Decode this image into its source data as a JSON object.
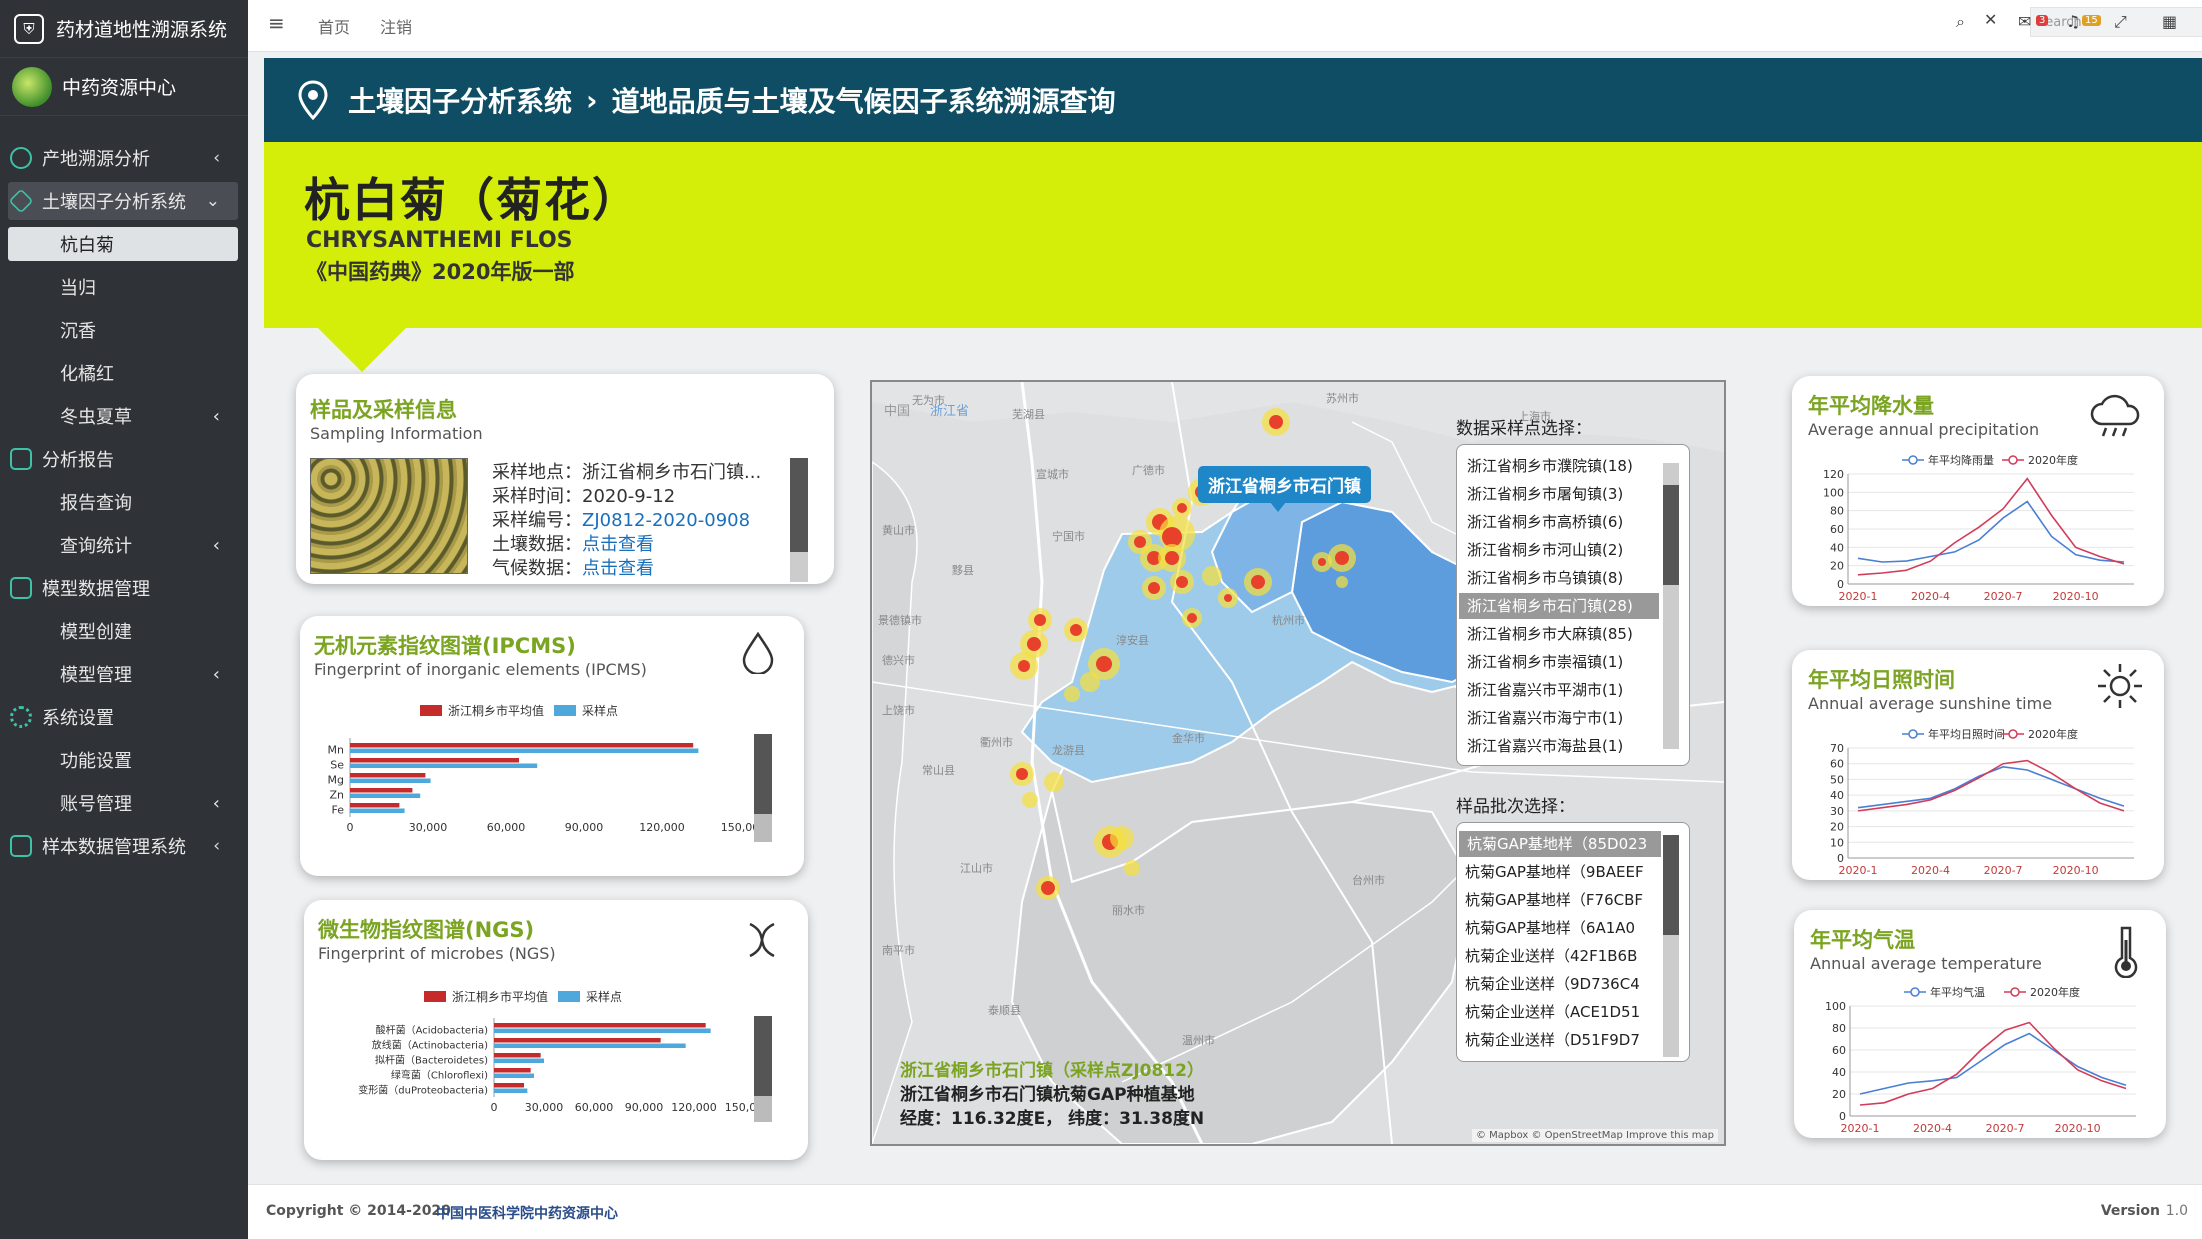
{
  "app": {
    "title": "药材道地性溯源系统",
    "center": "中药资源中心"
  },
  "sidebar": {
    "items": [
      {
        "label": "产地溯源分析"
      },
      {
        "label": "土壤因子分析系统"
      },
      {
        "label": "杭白菊"
      },
      {
        "label": "当归"
      },
      {
        "label": "沉香"
      },
      {
        "label": "化橘红"
      },
      {
        "label": "冬虫夏草"
      },
      {
        "label": "分析报告"
      },
      {
        "label": "报告查询"
      },
      {
        "label": "查询统计"
      },
      {
        "label": "模型数据管理"
      },
      {
        "label": "模型创建"
      },
      {
        "label": "模型管理"
      },
      {
        "label": "系统设置"
      },
      {
        "label": "功能设置"
      },
      {
        "label": "账号管理"
      },
      {
        "label": "样本数据管理系统"
      }
    ]
  },
  "topbar": {
    "home": "首页",
    "logout": "注销",
    "search_placeholder": "Search",
    "msg_count": "3",
    "notif_count": "15"
  },
  "breadcrumb": {
    "part1": "土壤因子分析系统",
    "part2": "道地品质与土壤及气候因子系统溯源查询"
  },
  "herb": {
    "name_cn": "杭白菊（菊花）",
    "name_latin": "CHRYSANTHEMI FLOS",
    "pharmacopoeia": "《中国药典》2020年版一部"
  },
  "sampling": {
    "title": "样品及采样信息",
    "subtitle": "Sampling Information",
    "location_label": "采样地点：",
    "location_value": "浙江省桐乡市石门镇...",
    "time_label": "采样时间：",
    "time_value": "2020-9-12",
    "code_label": "采样编号：",
    "code_value": "ZJ0812-2020-0908",
    "soil_label": "土壤数据：",
    "soil_link": "点击查看",
    "climate_label": "气候数据：",
    "climate_link": "点击查看"
  },
  "ipcms": {
    "title": "无机元素指纹图谱(IPCMS)",
    "subtitle": "Fingerprint of inorganic elements (IPCMS)",
    "legend": [
      "浙江桐乡市平均值",
      "采样点"
    ],
    "chart_data": {
      "type": "bar",
      "categories": [
        "Mn",
        "Se",
        "Mg",
        "Zn",
        "Fe"
      ],
      "series": [
        {
          "name": "浙江桐乡市平均值",
          "values": [
            132000,
            65000,
            29000,
            24000,
            19000
          ],
          "color": "#c62b2b"
        },
        {
          "name": "采样点",
          "values": [
            134000,
            72000,
            31000,
            27000,
            21000
          ],
          "color": "#4fa8dc"
        }
      ],
      "xticks": [
        "0",
        "30,000",
        "60,000",
        "90,000",
        "120,000",
        "150,00"
      ],
      "xlim": [
        0,
        150000
      ]
    }
  },
  "ngs": {
    "title": "微生物指纹图谱(NGS)",
    "subtitle": "Fingerprint of microbes (NGS)",
    "legend": [
      "浙江桐乡市平均值",
      "采样点"
    ],
    "chart_data": {
      "type": "bar",
      "categories": [
        "酸杆菌（Acidobacteria)",
        "放线菌（Actinobacteria)",
        "拟杆菌（Bacteroidetes)",
        "绿弯菌（Chloroflexi)",
        "变形菌（duProteobacteria)"
      ],
      "series": [
        {
          "name": "浙江桐乡市平均值",
          "values": [
            127000,
            100000,
            28000,
            22000,
            18000
          ],
          "color": "#c62b2b"
        },
        {
          "name": "采样点",
          "values": [
            130000,
            115000,
            30000,
            24000,
            20000
          ],
          "color": "#4fa8dc"
        }
      ],
      "xticks": [
        "0",
        "30,000",
        "60,000",
        "90,000",
        "120,000",
        "150,00"
      ],
      "xlim": [
        0,
        150000
      ]
    }
  },
  "map": {
    "tag_cn": "中国",
    "tag_zj": "浙江省",
    "popup": "浙江省桐乡市石门镇",
    "site_title": "浙江省桐乡市石门镇（采样点ZJ0812）",
    "site_desc": "浙江省桐乡市石门镇杭菊GAP种植基地",
    "site_coords": "经度：116.32度E，  纬度：31.38度N",
    "attribution": "© Mapbox © OpenStreetMap Improve this map",
    "place_labels": [
      "无为市",
      "苏州市",
      "芜湖县",
      "广德市",
      "上海市",
      "宣城市",
      "宁国市",
      "杭州市",
      "淳安县",
      "衢州市",
      "龙游县",
      "金华市",
      "丽水市",
      "温州市",
      "台州市",
      "景德镇市",
      "黟县",
      "常山县",
      "江山市",
      "泰顺县",
      "黄山市",
      "南平市",
      "德兴市",
      "上饶市"
    ],
    "sample_point_title": "数据采样点选择：",
    "sample_points": [
      "浙江省桐乡市濮院镇(18)",
      "浙江省桐乡市屠甸镇(3)",
      "浙江省桐乡市高桥镇(6)",
      "浙江省桐乡市河山镇(2)",
      "浙江省桐乡市乌镇镇(8)",
      "浙江省桐乡市石门镇(28)",
      "浙江省桐乡市大麻镇(85)",
      "浙江省桐乡市崇福镇(1)",
      "浙江省嘉兴市平湖市(1)",
      "浙江省嘉兴市海宁市(1)",
      "浙江省嘉兴市海盐县(1)"
    ],
    "batch_title": "样品批次选择：",
    "batches": [
      "杭菊GAP基地样（85D023",
      "杭菊GAP基地样（9BAEEF",
      "杭菊GAP基地样（F76CBF",
      "杭菊GAP基地样（6A1A0",
      "杭菊企业送样（42F1B6B",
      "杭菊企业送样（9D736C4",
      "杭菊企业送样（ACE1D51",
      "杭菊企业送样（D51F9D7"
    ]
  },
  "precip": {
    "title": "年平均降水量",
    "subtitle": "Average annual precipitation",
    "legend": [
      "年平均降雨量",
      "2020年度"
    ],
    "chart_data": {
      "type": "line",
      "x": [
        "2020-1",
        "2020-2",
        "2020-3",
        "2020-4",
        "2020-5",
        "2020-6",
        "2020-7",
        "2020-8",
        "2020-9",
        "2020-10",
        "2020-11",
        "2020-12"
      ],
      "series": [
        {
          "name": "年平均降雨量",
          "values": [
            28,
            24,
            25,
            30,
            35,
            48,
            72,
            90,
            52,
            32,
            26,
            24
          ],
          "color": "#4a7fd4"
        },
        {
          "name": "2020年度",
          "values": [
            10,
            12,
            15,
            25,
            45,
            62,
            82,
            115,
            75,
            40,
            30,
            22
          ],
          "color": "#d23c5a"
        }
      ],
      "yticks": [
        0,
        20,
        40,
        60,
        80,
        100,
        120
      ],
      "xticks": [
        "2020-1",
        "2020-4",
        "2020-7",
        "2020-10"
      ],
      "ylim": [
        0,
        120
      ]
    }
  },
  "sunshine": {
    "title": "年平均日照时间",
    "subtitle": "Annual average sunshine time",
    "legend": [
      "年平均日照时间",
      "2020年度"
    ],
    "chart_data": {
      "type": "line",
      "x": [
        "2020-1",
        "2020-2",
        "2020-3",
        "2020-4",
        "2020-5",
        "2020-6",
        "2020-7",
        "2020-8",
        "2020-9",
        "2020-10",
        "2020-11",
        "2020-12"
      ],
      "series": [
        {
          "name": "年平均日照时间",
          "values": [
            32,
            34,
            36,
            38,
            44,
            52,
            58,
            56,
            50,
            44,
            38,
            33
          ],
          "color": "#4a7fd4"
        },
        {
          "name": "2020年度",
          "values": [
            30,
            32,
            34,
            37,
            43,
            51,
            60,
            62,
            54,
            44,
            35,
            30
          ],
          "color": "#d23c5a"
        }
      ],
      "yticks": [
        0,
        10,
        20,
        30,
        40,
        50,
        60,
        70
      ],
      "xticks": [
        "2020-1",
        "2020-4",
        "2020-7",
        "2020-10"
      ],
      "ylim": [
        0,
        70
      ]
    }
  },
  "temp": {
    "title": "年平均气温",
    "subtitle": "Annual average temperature",
    "legend": [
      "年平均气温",
      "2020年度"
    ],
    "chart_data": {
      "type": "line",
      "x": [
        "2020-1",
        "2020-2",
        "2020-3",
        "2020-4",
        "2020-5",
        "2020-6",
        "2020-7",
        "2020-8",
        "2020-9",
        "2020-10",
        "2020-11",
        "2020-12"
      ],
      "series": [
        {
          "name": "年平均气温",
          "values": [
            20,
            25,
            30,
            32,
            35,
            50,
            65,
            75,
            60,
            45,
            35,
            28
          ],
          "color": "#4a7fd4"
        },
        {
          "name": "2020年度",
          "values": [
            10,
            12,
            20,
            25,
            38,
            60,
            78,
            85,
            62,
            42,
            32,
            25
          ],
          "color": "#d23c5a"
        }
      ],
      "yticks": [
        0,
        20,
        40,
        60,
        80,
        100
      ],
      "xticks": [
        "2020-1",
        "2020-4",
        "2020-7",
        "2020-10"
      ],
      "ylim": [
        0,
        100
      ]
    }
  },
  "footer": {
    "copyright": "Copyright © 2014-2020",
    "org": "中国中医科学院中药资源中心",
    "version_label": "Version",
    "version": "1.0"
  }
}
